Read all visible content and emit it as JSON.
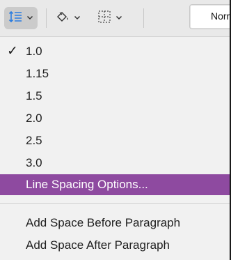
{
  "toolbar": {
    "line_spacing_icon": "line-spacing-icon",
    "shading_icon": "shading-icon",
    "borders_icon": "borders-icon",
    "style_preview": "Norr"
  },
  "menu": {
    "items": [
      {
        "label": "1.0",
        "checked": true
      },
      {
        "label": "1.15",
        "checked": false
      },
      {
        "label": "1.5",
        "checked": false
      },
      {
        "label": "2.0",
        "checked": false
      },
      {
        "label": "2.5",
        "checked": false
      },
      {
        "label": "3.0",
        "checked": false
      }
    ],
    "options_label": "Line Spacing Options...",
    "add_before_label": "Add Space Before Paragraph",
    "add_after_label": "Add Space After Paragraph",
    "check_glyph": "✓"
  },
  "colors": {
    "highlight": "#8e4aa0",
    "menu_bg": "#f1f1f1",
    "toolbar_bg": "#e9e9e9"
  }
}
